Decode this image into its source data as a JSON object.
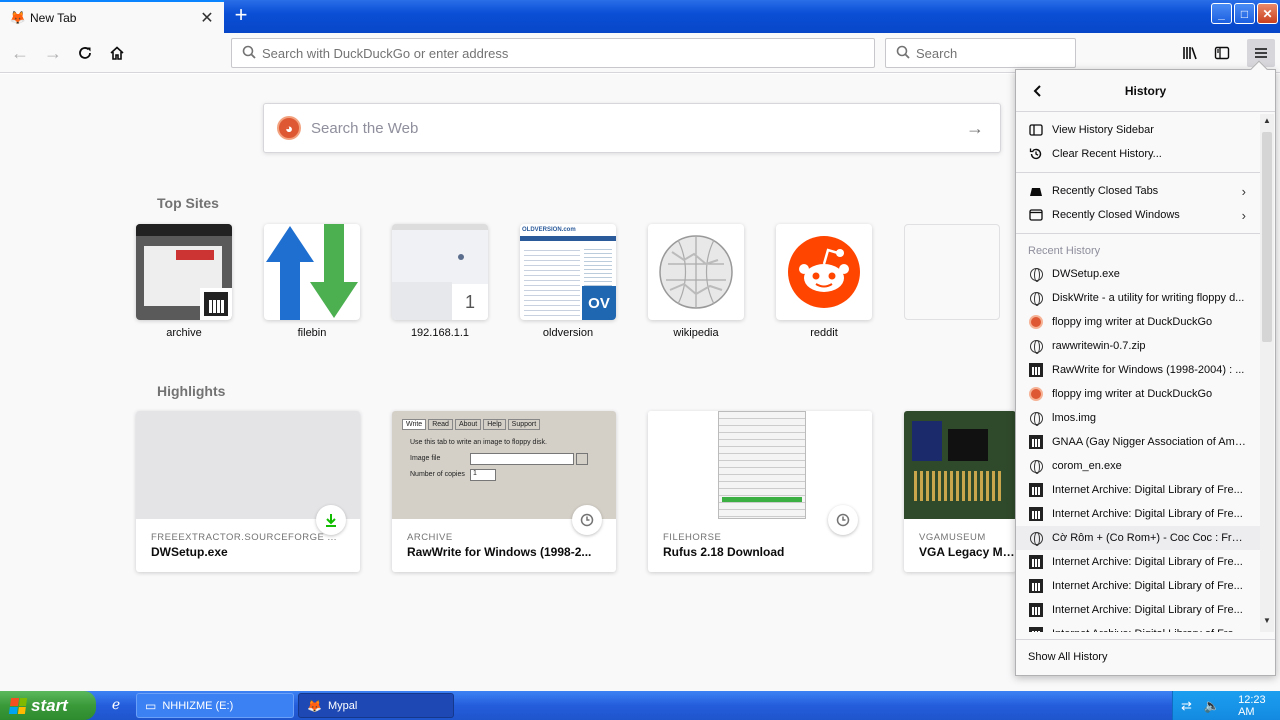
{
  "window": {
    "tab_title": "New Tab",
    "tab_favicon": "mypal-icon",
    "new_tab_label": "+",
    "controls": {
      "minimize": "_",
      "maximize": "□",
      "close": "✕"
    }
  },
  "navbar": {
    "url_placeholder": "Search with DuckDuckGo or enter address",
    "search_placeholder": "Search"
  },
  "newtab": {
    "web_search_placeholder": "Search the Web",
    "top_sites_title": "Top Sites",
    "top_sites": [
      {
        "label": "archive"
      },
      {
        "label": "filebin"
      },
      {
        "label": "192.168.1.1"
      },
      {
        "label": "oldversion"
      },
      {
        "label": "wikipedia"
      },
      {
        "label": "reddit"
      },
      {
        "label": ""
      }
    ],
    "highlights_title": "Highlights",
    "highlights": [
      {
        "source": "FREEEXTRACTOR.SOURCEFORGE ...",
        "title": "DWSetup.exe",
        "badge": "download-icon"
      },
      {
        "source": "ARCHIVE",
        "title": "RawWrite for Windows (1998-2...",
        "badge": "clock-icon"
      },
      {
        "source": "FILEHORSE",
        "title": "Rufus 2.18 Download",
        "badge": "clock-icon"
      },
      {
        "source": "VGAMUSEUM",
        "title": "VGA Legacy MKIII",
        "badge": "clock-icon"
      }
    ],
    "thumb_text": {
      "tab_count": "1",
      "oldversion_logo": "OLDVERSION.com",
      "oldversion_badge": "OV",
      "rawwrite_tabs": [
        "Write",
        "Read",
        "About",
        "Help",
        "Support"
      ],
      "rawwrite_instruction": "Use this tab to write an image to floppy disk.",
      "rawwrite_image_file": "Image file",
      "rawwrite_copies": "Number of copies",
      "rawwrite_copies_value": "1"
    }
  },
  "history_panel": {
    "title": "History",
    "view_sidebar": "View History Sidebar",
    "clear_recent": "Clear Recent History...",
    "recently_closed_tabs": "Recently Closed Tabs",
    "recently_closed_windows": "Recently Closed Windows",
    "recent_heading": "Recent History",
    "items": [
      {
        "label": "DWSetup.exe",
        "icon": "globe-icon"
      },
      {
        "label": "DiskWrite - a utility for writing floppy d...",
        "icon": "globe-icon"
      },
      {
        "label": "floppy img writer at DuckDuckGo",
        "icon": "duckduckgo-icon"
      },
      {
        "label": "rawwritewin-0.7.zip",
        "icon": "globe-icon"
      },
      {
        "label": "RawWrite for Windows (1998-2004) : ...",
        "icon": "archive-icon"
      },
      {
        "label": "floppy img writer at DuckDuckGo",
        "icon": "duckduckgo-icon"
      },
      {
        "label": "lmos.img",
        "icon": "globe-icon"
      },
      {
        "label": "GNAA (Gay Nigger Association of Ame...",
        "icon": "archive-icon"
      },
      {
        "label": "corom_en.exe",
        "icon": "globe-icon"
      },
      {
        "label": "Internet Archive: Digital Library of Fre...",
        "icon": "archive-icon"
      },
      {
        "label": "Internet Archive: Digital Library of Fre...",
        "icon": "archive-icon"
      },
      {
        "label": "Cờ Rôm + (Co Rom+) - Coc Coc : Free...",
        "icon": "globe-icon"
      },
      {
        "label": "Internet Archive: Digital Library of Fre...",
        "icon": "archive-icon"
      },
      {
        "label": "Internet Archive: Digital Library of Fre...",
        "icon": "archive-icon"
      },
      {
        "label": "Internet Archive: Digital Library of Fre...",
        "icon": "archive-icon"
      },
      {
        "label": "Internet Archive: Digital Library of Fre...",
        "icon": "archive-icon"
      }
    ],
    "show_all": "Show All History"
  },
  "taskbar": {
    "start_label": "start",
    "tasks": [
      {
        "label": "NHHIZME (E:)",
        "icon": "drive-icon"
      },
      {
        "label": "Mypal",
        "icon": "mypal-icon"
      }
    ],
    "clock": "12:23 AM"
  },
  "colors": {
    "accent": "#0a84ff",
    "duckduckgo": "#de5833",
    "reddit": "#ff4500",
    "filebin_blue": "#1f6fd1",
    "filebin_green": "#4caf50",
    "xp_blue": "#245ddb",
    "xp_green": "#3a9a3a"
  }
}
